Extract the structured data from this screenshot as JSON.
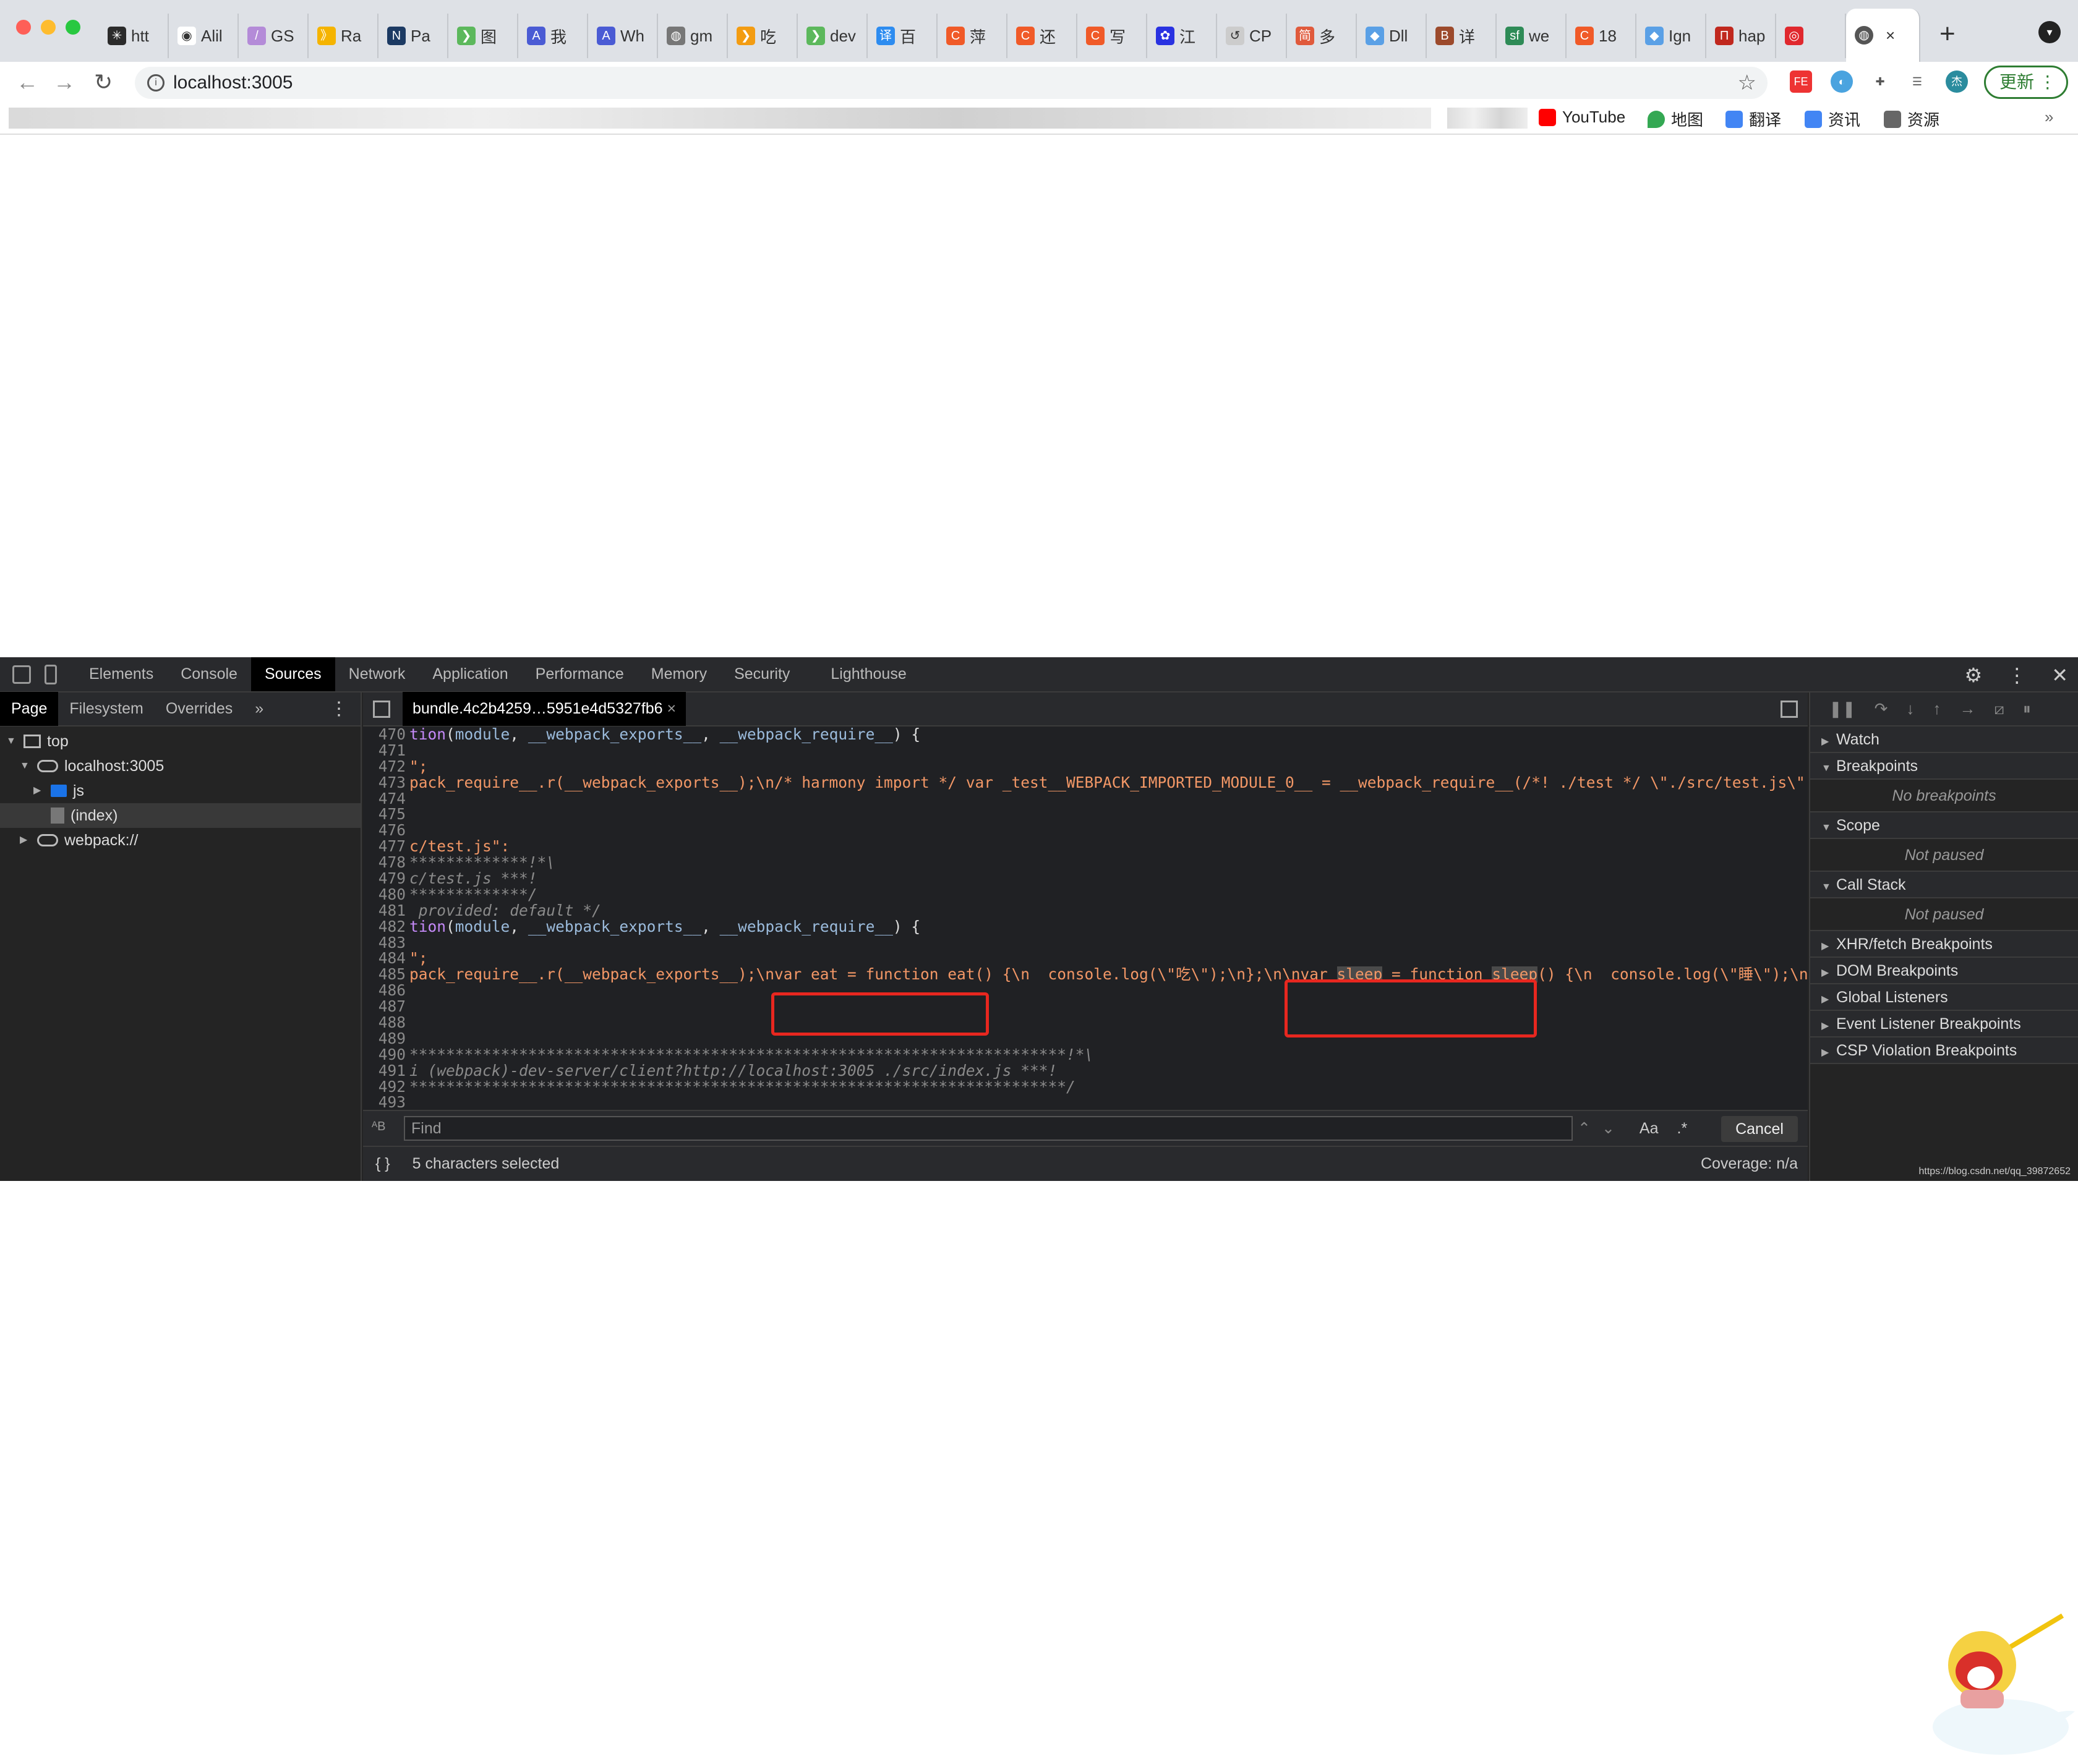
{
  "browser": {
    "tabs": [
      {
        "label": "htt",
        "fav": "#2b2b2b",
        "glyph": "✳"
      },
      {
        "label": "Alil",
        "fav": "#fff",
        "glyph": "◉"
      },
      {
        "label": "GS",
        "fav": "#b48bd8",
        "glyph": "/"
      },
      {
        "label": "Ra",
        "fav": "#f5b400",
        "glyph": "》"
      },
      {
        "label": "Pa",
        "fav": "#1c3a63",
        "glyph": "N"
      },
      {
        "label": "图",
        "fav": "#5cb85c",
        "glyph": "❯"
      },
      {
        "label": "我",
        "fav": "#4a5bd4",
        "glyph": "A"
      },
      {
        "label": "Wh",
        "fav": "#4a5bd4",
        "glyph": "A"
      },
      {
        "label": "gm",
        "fav": "#777",
        "glyph": "◍"
      },
      {
        "label": "吃",
        "fav": "#f39c12",
        "glyph": "❯"
      },
      {
        "label": "dev",
        "fav": "#5cb85c",
        "glyph": "❯"
      },
      {
        "label": "百",
        "fav": "#2d8cf0",
        "glyph": "译"
      },
      {
        "label": "萍",
        "fav": "#f05a28",
        "glyph": "C"
      },
      {
        "label": "还",
        "fav": "#f05a28",
        "glyph": "C"
      },
      {
        "label": "写",
        "fav": "#f05a28",
        "glyph": "C"
      },
      {
        "label": "江",
        "fav": "#2932e1",
        "glyph": "✿"
      },
      {
        "label": "CP",
        "fav": "#ccc",
        "glyph": "↺"
      },
      {
        "label": "多",
        "fav": "#e05a3c",
        "glyph": "简"
      },
      {
        "label": "Dll",
        "fav": "#5aa0e6",
        "glyph": "◆"
      },
      {
        "label": "详",
        "fav": "#9c4a2c",
        "glyph": "B"
      },
      {
        "label": "we",
        "fav": "#2e8b57",
        "glyph": "sf"
      },
      {
        "label": "18",
        "fav": "#f05a28",
        "glyph": "C"
      },
      {
        "label": "Ign",
        "fav": "#5aa0e6",
        "glyph": "◆"
      },
      {
        "label": "hap",
        "fav": "#c0281e",
        "glyph": "П"
      },
      {
        "label": "",
        "fav": "#e0282e",
        "glyph": "◎"
      }
    ],
    "active_tab_close": "×",
    "url": "localhost:3005",
    "update_label": "更新",
    "avatar": "杰",
    "bookmarks": [
      "YouTube",
      "地图",
      "翻译",
      "资讯",
      "资源"
    ],
    "bookmarks_more": "»"
  },
  "devtools": {
    "tabs": [
      "Elements",
      "Console",
      "Sources",
      "Network",
      "Application",
      "Performance",
      "Memory",
      "Security",
      "Lighthouse"
    ],
    "active_tab": "Sources",
    "nav_tabs": [
      "Page",
      "Filesystem",
      "Overrides",
      "»"
    ],
    "tree": [
      {
        "label": "top",
        "indent": 0,
        "tri": "▼",
        "icon": "box"
      },
      {
        "label": "localhost:3005",
        "indent": 1,
        "tri": "▼",
        "icon": "cloud"
      },
      {
        "label": "js",
        "indent": 2,
        "tri": "▶",
        "icon": "folder"
      },
      {
        "label": "(index)",
        "indent": 2,
        "tri": "",
        "icon": "file",
        "selected": true
      },
      {
        "label": "webpack://",
        "indent": 1,
        "tri": "▶",
        "icon": "cloud"
      }
    ],
    "editor_tab": "bundle.4c2b4259…5951e4d5327fb6",
    "editor_tab_close": "×",
    "code": [
      {
        "n": "470",
        "t": [
          [
            "tion",
            "k-kw"
          ],
          [
            "(",
            "k-pl"
          ],
          [
            "module",
            "k-def"
          ],
          [
            ", ",
            "k-pl"
          ],
          [
            "__webpack_exports__",
            "k-def"
          ],
          [
            ", ",
            "k-pl"
          ],
          [
            "__webpack_require__",
            "k-def"
          ],
          [
            ") {",
            "k-pl"
          ]
        ]
      },
      {
        "n": "471",
        "t": []
      },
      {
        "n": "472",
        "t": [
          [
            "\";",
            "k-str"
          ]
        ]
      },
      {
        "n": "473",
        "t": [
          [
            "pack_require__.r(__webpack_exports__);\\n/* harmony import */ var _test__WEBPACK_IMPORTED_MODULE_0__ = __webpack_require__(/*! ./test */ \\\"./src/test.js\\\")",
            "k-str"
          ]
        ]
      },
      {
        "n": "474",
        "t": []
      },
      {
        "n": "475",
        "t": []
      },
      {
        "n": "476",
        "t": []
      },
      {
        "n": "477",
        "t": [
          [
            "c/test.js\":",
            "k-str"
          ]
        ]
      },
      {
        "n": "478",
        "t": [
          [
            "*************!*\\",
            "k-com"
          ]
        ]
      },
      {
        "n": "479",
        "t": [
          [
            "c/test.js ***!",
            "k-com"
          ]
        ]
      },
      {
        "n": "480",
        "t": [
          [
            "*************/",
            "k-com"
          ]
        ]
      },
      {
        "n": "481",
        "t": [
          [
            " provided: default */",
            "k-com"
          ]
        ]
      },
      {
        "n": "482",
        "t": [
          [
            "tion",
            "k-kw"
          ],
          [
            "(",
            "k-pl"
          ],
          [
            "module",
            "k-def"
          ],
          [
            ", ",
            "k-pl"
          ],
          [
            "__webpack_exports__",
            "k-def"
          ],
          [
            ", ",
            "k-pl"
          ],
          [
            "__webpack_require__",
            "k-def"
          ],
          [
            ") {",
            "k-pl"
          ]
        ]
      },
      {
        "n": "483",
        "t": []
      },
      {
        "n": "484",
        "t": [
          [
            "\";",
            "k-str"
          ]
        ]
      },
      {
        "n": "485",
        "t": [
          [
            "pack_require__.r(__webpack_exports__);\\nvar eat = function eat() {\\n  console.log(\\\"吃\\\");\\n};\\n\\nvar ",
            "k-str"
          ],
          [
            "sleep",
            "k-str hl"
          ],
          [
            " = function ",
            "k-str"
          ],
          [
            "sleep",
            "k-str hl"
          ],
          [
            "() {\\n  console.log(\\\"睡\\\");\\n}",
            "k-str"
          ]
        ]
      },
      {
        "n": "486",
        "t": []
      },
      {
        "n": "487",
        "t": []
      },
      {
        "n": "488",
        "t": []
      },
      {
        "n": "489",
        "t": []
      },
      {
        "n": "490",
        "t": [
          [
            "************************************************************************!*\\",
            "k-com"
          ]
        ]
      },
      {
        "n": "491",
        "t": [
          [
            "i (webpack)-dev-server/client?http://localhost:3005 ./src/index.js ***!",
            "k-com"
          ]
        ]
      },
      {
        "n": "492",
        "t": [
          [
            "************************************************************************/",
            "k-com"
          ]
        ]
      },
      {
        "n": "493",
        "t": []
      }
    ],
    "find_placeholder": "Find",
    "find_case": "Aa",
    "find_regex": ".*",
    "cancel_label": "Cancel",
    "status_selection": "5 characters selected",
    "status_coverage": "Coverage: n/a",
    "status_pretty": "{ }",
    "sidebar": [
      {
        "label": "Watch",
        "open": false
      },
      {
        "label": "Breakpoints",
        "open": true,
        "empty": "No breakpoints"
      },
      {
        "label": "Scope",
        "open": true,
        "empty": "Not paused"
      },
      {
        "label": "Call Stack",
        "open": true,
        "empty": "Not paused"
      },
      {
        "label": "XHR/fetch Breakpoints",
        "open": false
      },
      {
        "label": "DOM Breakpoints",
        "open": false
      },
      {
        "label": "Global Listeners",
        "open": false
      },
      {
        "label": "Event Listener Breakpoints",
        "open": false
      },
      {
        "label": "CSP Violation Breakpoints",
        "open": false
      }
    ]
  },
  "watermark": "https://blog.csdn.net/qq_39872652",
  "colors": {
    "annotation": "#e8271f",
    "accent": "#1a73e8"
  }
}
